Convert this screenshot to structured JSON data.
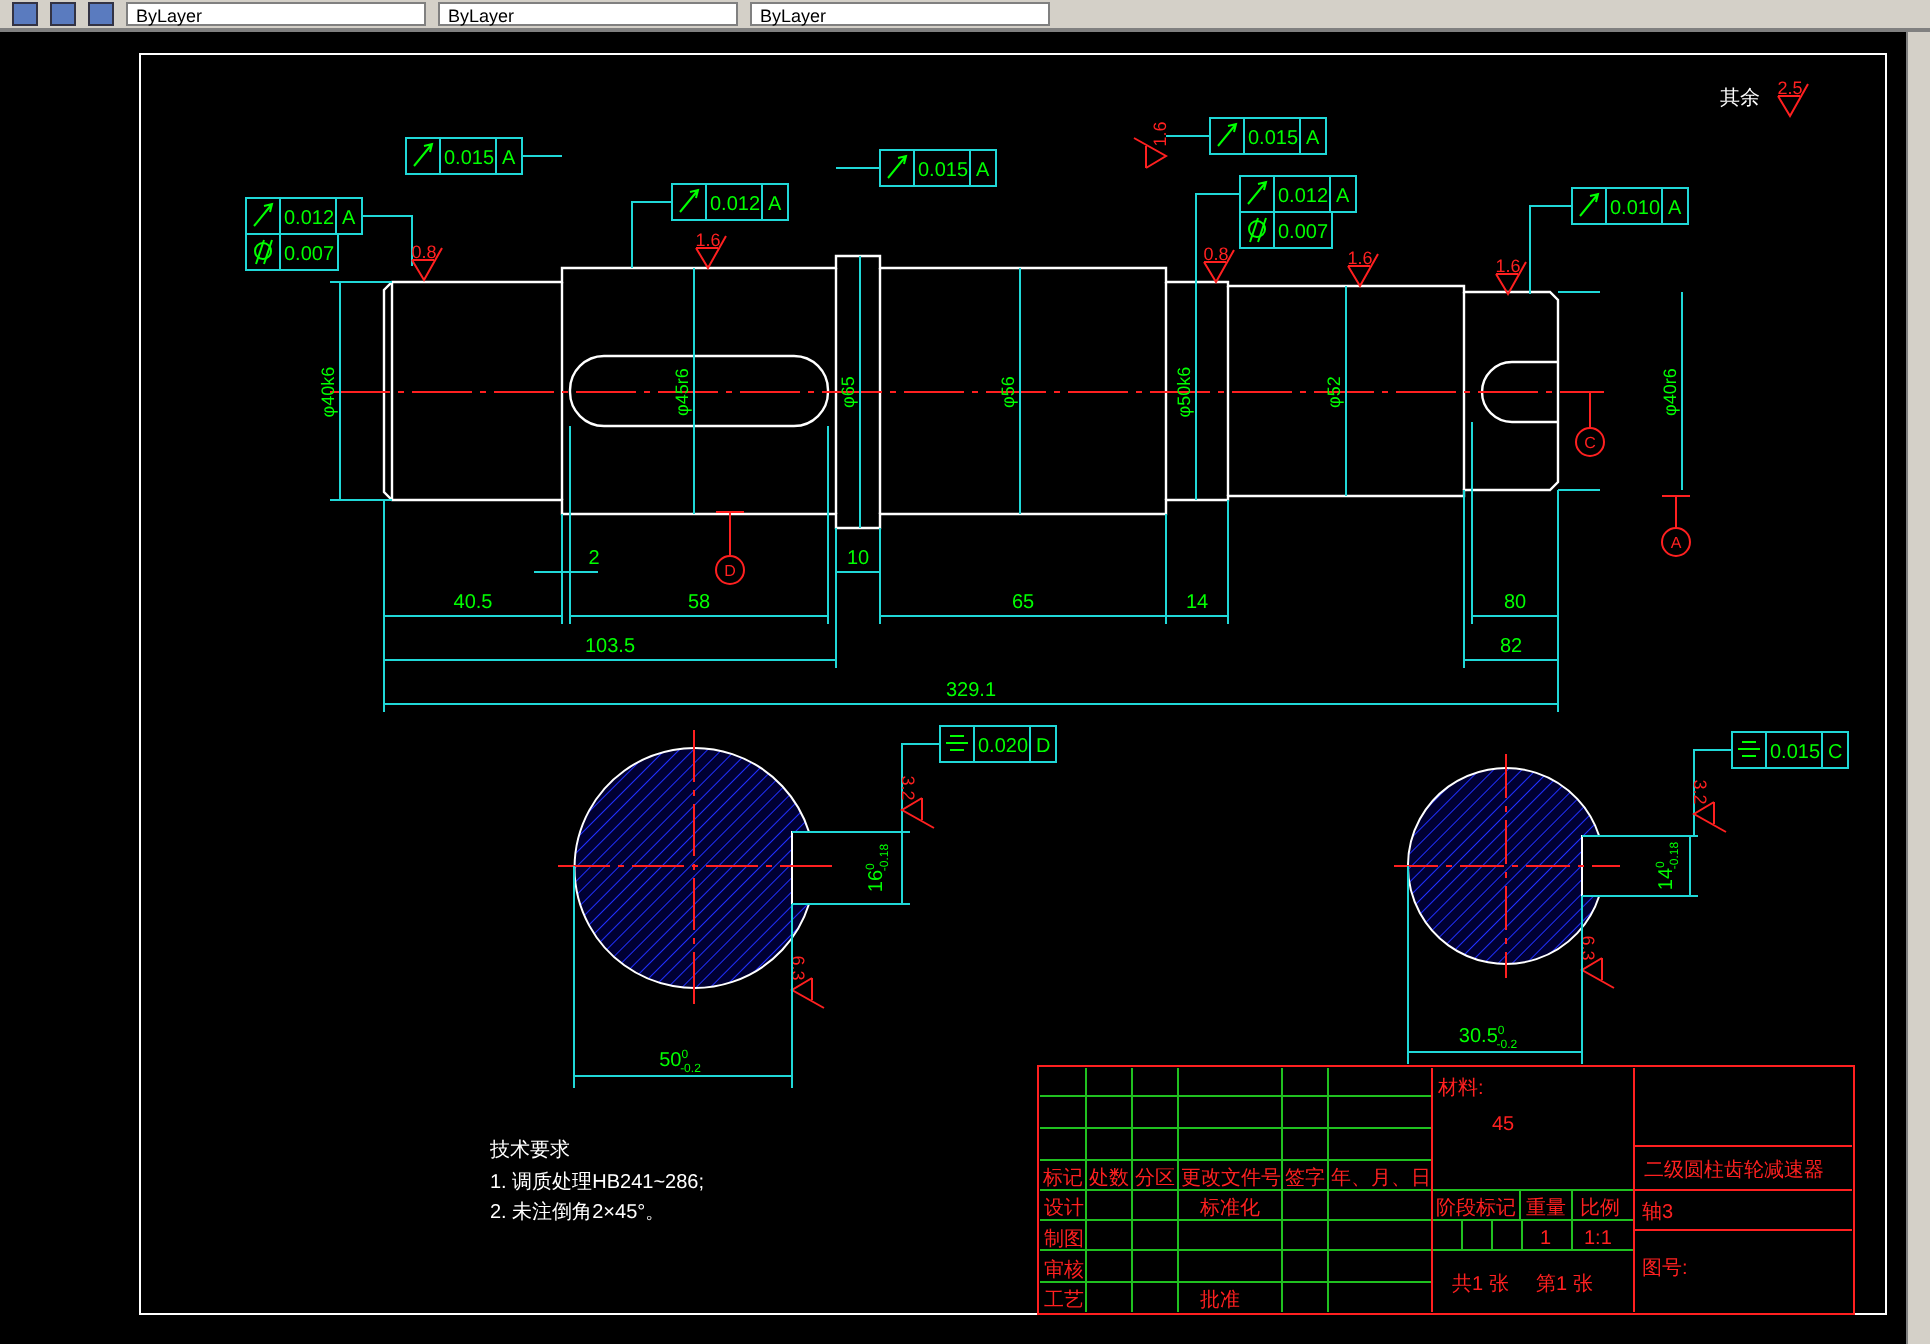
{
  "toolbar": {
    "dropdowns": [
      {
        "label": "ByLayer"
      },
      {
        "label": "ByLayer"
      },
      {
        "label": "ByLayer"
      }
    ]
  },
  "drawing": {
    "surface_note": {
      "label": "其余",
      "roughness": "2.5"
    },
    "tolerance_frames": [
      {
        "rows": [
          {
            "kind": "runout",
            "value": "0.015",
            "datum": "A"
          }
        ]
      },
      {
        "rows": [
          {
            "kind": "runout",
            "value": "0.012",
            "datum": "A"
          },
          {
            "kind": "cylindricity",
            "value": "0.007"
          }
        ]
      },
      {
        "rows": [
          {
            "kind": "runout",
            "value": "0.012",
            "datum": "A"
          }
        ]
      },
      {
        "rows": [
          {
            "kind": "runout",
            "value": "0.015",
            "datum": "A"
          }
        ]
      },
      {
        "rows": [
          {
            "kind": "runout",
            "value": "0.015",
            "datum": "A"
          }
        ]
      },
      {
        "rows": [
          {
            "kind": "runout",
            "value": "0.012",
            "datum": "A"
          },
          {
            "kind": "cylindricity",
            "value": "0.007"
          }
        ]
      },
      {
        "rows": [
          {
            "kind": "runout",
            "value": "0.010",
            "datum": "A"
          }
        ]
      },
      {
        "rows": [
          {
            "kind": "symmetry",
            "value": "0.020",
            "datum": "D"
          }
        ]
      },
      {
        "rows": [
          {
            "kind": "symmetry",
            "value": "0.015",
            "datum": "C"
          }
        ]
      }
    ],
    "roughness_marks": [
      "0.8",
      "1.6",
      "1.6",
      "0.8",
      "1.6",
      "1.6",
      "3.2",
      "6.3",
      "3.2",
      "6.3"
    ],
    "datum_marks": [
      "D",
      "C",
      "A"
    ],
    "length_dims": [
      "40.5",
      "2",
      "58",
      "10",
      "65",
      "14",
      "80",
      "82",
      "103.5",
      "329.1"
    ],
    "diameter_dims": [
      "φ40k6",
      "φ45r6",
      "φ65",
      "φ56",
      "φ50k6",
      "φ52",
      "φ40r6"
    ],
    "section_dims": [
      {
        "main": "16",
        "upper": "0",
        "lower": "-0.18"
      },
      {
        "main": "50",
        "upper": "0",
        "lower": "-0.2"
      },
      {
        "main": "14",
        "upper": "0",
        "lower": "-0.18"
      },
      {
        "main": "30.5",
        "upper": "0",
        "lower": "-0.2"
      }
    ],
    "technical_requirements": {
      "title": "技术要求",
      "items": [
        "1. 调质处理HB241~286;",
        "2. 未注倒角2×45°。"
      ]
    },
    "title_block": {
      "header_cells": [
        "标记",
        "处数",
        "分区",
        "更改文件号",
        "签字",
        "年、月、日"
      ],
      "role_labels": [
        "设计",
        "制图",
        "审核",
        "工艺"
      ],
      "standardization": "标准化",
      "approval": "批准",
      "material_label": "材料:",
      "material": "45",
      "stage_headers": [
        "阶段标记",
        "重量",
        "比例"
      ],
      "weight": "1",
      "scale": "1:1",
      "sheet_total": "共1 张",
      "sheet_number": "第1 张",
      "drawing_title": "二级圆柱齿轮减速器",
      "part_name": "轴3",
      "drawing_number_label": "图号:"
    }
  }
}
